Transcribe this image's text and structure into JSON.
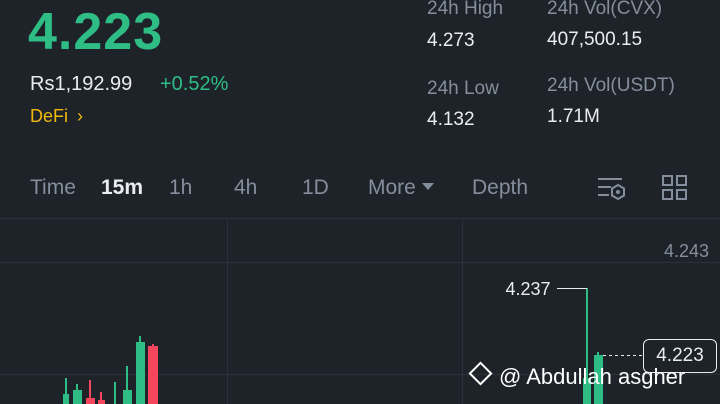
{
  "ticker": {
    "price": "4.223",
    "fiat_price": "Rs1,192.99",
    "change": "+0.52%",
    "category": "DeFi",
    "stats": {
      "high_label": "24h High",
      "high_value": "4.273",
      "low_label": "24h Low",
      "low_value": "4.132",
      "vol_base_label": "24h Vol(CVX)",
      "vol_base_value": "407,500.15",
      "vol_quote_label": "24h Vol(USDT)",
      "vol_quote_value": "1.71M"
    }
  },
  "tabs": {
    "time": "Time",
    "m15": "15m",
    "h1": "1h",
    "h4": "4h",
    "d1": "1D",
    "more": "More",
    "depth": "Depth"
  },
  "chart": {
    "axis_top": "4.243",
    "high_marker": "4.237",
    "current_price": "4.223"
  },
  "watermark": "@ Abdullah asgher",
  "colors": {
    "up": "#2ebd85",
    "down": "#f6465d",
    "accent": "#f0b90b",
    "background": "#1e2329"
  },
  "chart_data": {
    "type": "candlestick",
    "y_axis_labels": [
      "4.243"
    ],
    "annotations": [
      "4.237",
      "4.223"
    ]
  }
}
